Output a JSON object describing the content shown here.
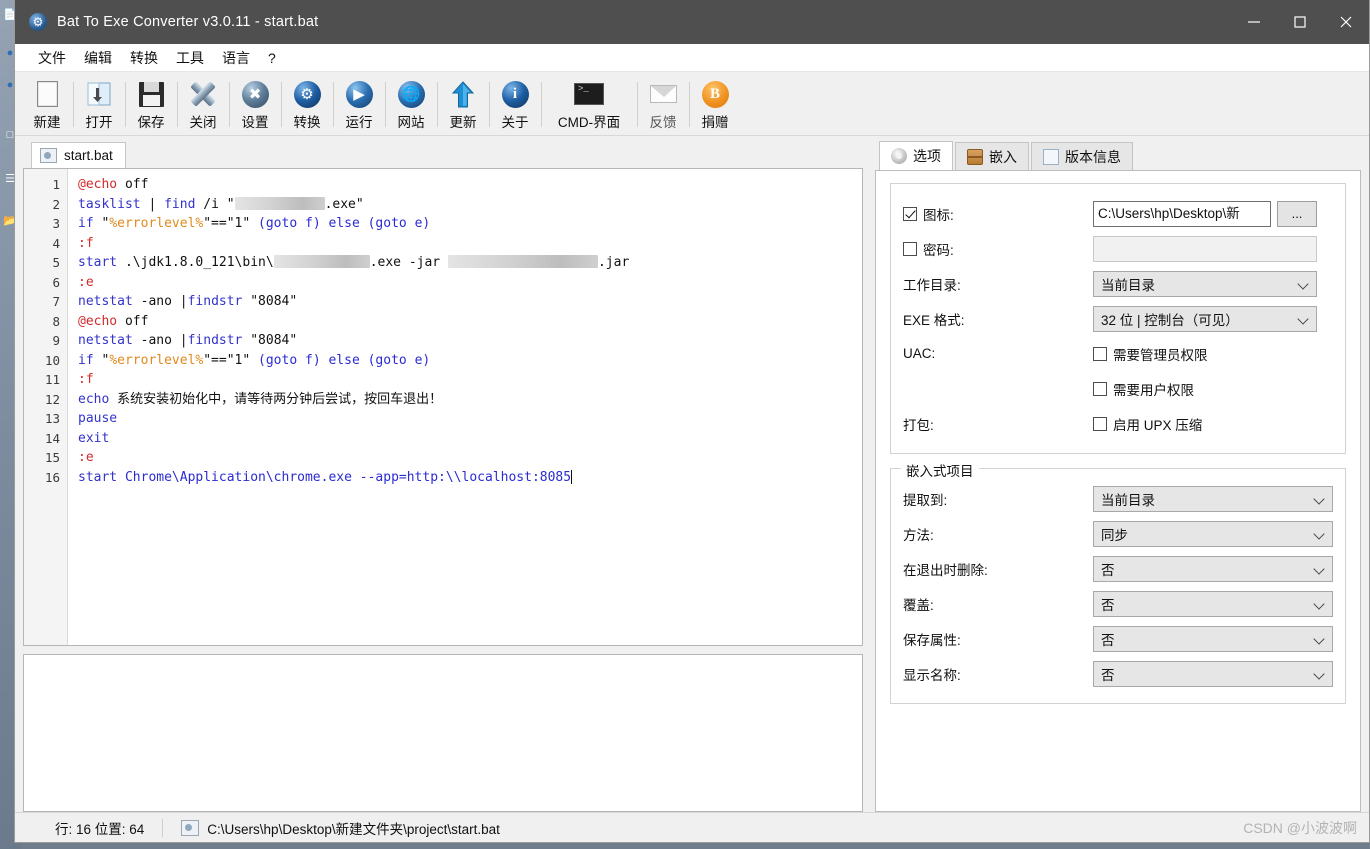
{
  "window": {
    "title": "Bat To Exe Converter v3.0.11 - start.bat",
    "app_icon": "gear-icon",
    "minimize": "minimize-icon",
    "maximize": "maximize-icon",
    "close": "close-icon"
  },
  "menu": {
    "items": [
      {
        "label": "文件"
      },
      {
        "label": "编辑"
      },
      {
        "label": "转换"
      },
      {
        "label": "工具"
      },
      {
        "label": "语言"
      },
      {
        "label": "?"
      }
    ]
  },
  "toolbar": {
    "items": [
      {
        "label": "新建",
        "icon": "new-file-icon"
      },
      {
        "label": "打开",
        "icon": "open-folder-icon"
      },
      {
        "label": "保存",
        "icon": "save-floppy-icon"
      },
      {
        "label": "关闭",
        "icon": "close-x-icon"
      },
      {
        "label": "设置",
        "icon": "settings-tools-icon"
      },
      {
        "label": "转换",
        "icon": "convert-gear-icon"
      },
      {
        "label": "运行",
        "icon": "run-play-icon"
      },
      {
        "label": "网站",
        "icon": "website-globe-icon"
      },
      {
        "label": "更新",
        "icon": "update-arrow-up-icon"
      },
      {
        "label": "关于",
        "icon": "about-info-icon"
      },
      {
        "label": "CMD-界面",
        "icon": "cmd-console-icon"
      },
      {
        "label": "反馈",
        "icon": "feedback-mail-icon"
      },
      {
        "label": "捐赠",
        "icon": "donate-bitcoin-icon"
      }
    ]
  },
  "editor": {
    "tab_label": "start.bat",
    "tab_icon": "bat-file-icon",
    "line_numbers": [
      1,
      2,
      3,
      4,
      5,
      6,
      7,
      8,
      9,
      10,
      11,
      12,
      13,
      14,
      15,
      16
    ],
    "lines": [
      {
        "n": 1,
        "tokens": [
          {
            "t": "@echo",
            "c": "at"
          },
          {
            "t": " off",
            "c": "plain"
          }
        ]
      },
      {
        "n": 2,
        "tokens": [
          {
            "t": "tasklist",
            "c": "kw"
          },
          {
            "t": " ",
            "c": "plain"
          },
          {
            "t": "|",
            "c": "pipe"
          },
          {
            "t": " ",
            "c": "plain"
          },
          {
            "t": "find",
            "c": "kw"
          },
          {
            "t": " /i \"",
            "c": "plain"
          },
          {
            "t": "REDACT:90",
            "c": "redact"
          },
          {
            "t": ".exe\"",
            "c": "plain"
          }
        ]
      },
      {
        "n": 3,
        "tokens": [
          {
            "t": "if",
            "c": "kw"
          },
          {
            "t": " \"",
            "c": "plain"
          },
          {
            "t": "%errorlevel%",
            "c": "var"
          },
          {
            "t": "\"==\"1\" ",
            "c": "plain"
          },
          {
            "t": "(goto f) else (goto e)",
            "c": "kw2"
          }
        ]
      },
      {
        "n": 4,
        "tokens": [
          {
            "t": ":f",
            "c": "label"
          }
        ]
      },
      {
        "n": 5,
        "tokens": [
          {
            "t": "start",
            "c": "kw"
          },
          {
            "t": " .\\jdk1.8.0_121\\bin\\",
            "c": "plain"
          },
          {
            "t": "REDACT:96",
            "c": "redact"
          },
          {
            "t": ".exe -jar ",
            "c": "plain"
          },
          {
            "t": "REDACT:150",
            "c": "redact"
          },
          {
            "t": ".jar",
            "c": "plain"
          }
        ]
      },
      {
        "n": 6,
        "tokens": [
          {
            "t": ":e",
            "c": "label"
          }
        ]
      },
      {
        "n": 7,
        "tokens": [
          {
            "t": "netstat",
            "c": "kw"
          },
          {
            "t": " -ano ",
            "c": "plain"
          },
          {
            "t": "|",
            "c": "pipe"
          },
          {
            "t": "findstr",
            "c": "kw"
          },
          {
            "t": " \"8084\"",
            "c": "plain"
          }
        ]
      },
      {
        "n": 8,
        "tokens": [
          {
            "t": "@echo",
            "c": "at"
          },
          {
            "t": " off",
            "c": "plain"
          }
        ]
      },
      {
        "n": 9,
        "tokens": [
          {
            "t": "netstat",
            "c": "kw"
          },
          {
            "t": " -ano ",
            "c": "plain"
          },
          {
            "t": "|",
            "c": "pipe"
          },
          {
            "t": "findstr",
            "c": "kw"
          },
          {
            "t": " \"8084\"",
            "c": "plain"
          }
        ]
      },
      {
        "n": 10,
        "tokens": [
          {
            "t": "if",
            "c": "kw"
          },
          {
            "t": " \"",
            "c": "plain"
          },
          {
            "t": "%errorlevel%",
            "c": "var"
          },
          {
            "t": "\"==\"1\" ",
            "c": "plain"
          },
          {
            "t": "(goto f) else (goto e)",
            "c": "kw2"
          }
        ]
      },
      {
        "n": 11,
        "tokens": [
          {
            "t": ":f",
            "c": "label"
          }
        ]
      },
      {
        "n": 12,
        "tokens": [
          {
            "t": "echo",
            "c": "kw"
          },
          {
            "t": " 系统安装初始化中，请等待两分钟后尝试，按回车退出！",
            "c": "plain"
          }
        ]
      },
      {
        "n": 13,
        "tokens": [
          {
            "t": "pause",
            "c": "kw"
          }
        ]
      },
      {
        "n": 14,
        "tokens": [
          {
            "t": "exit",
            "c": "kw"
          }
        ]
      },
      {
        "n": 15,
        "tokens": [
          {
            "t": ":e",
            "c": "label"
          }
        ]
      },
      {
        "n": 16,
        "tokens": [
          {
            "t": "start",
            "c": "kw"
          },
          {
            "t": " Chrome\\Application\\chrome.exe --app=http:\\\\localhost:8085",
            "c": "kw2"
          },
          {
            "t": "CARET",
            "c": "caret"
          }
        ]
      }
    ]
  },
  "options_panel": {
    "tabs": [
      {
        "label": "选项",
        "icon": "gear-icon",
        "active": true
      },
      {
        "label": "嵌入",
        "icon": "package-icon",
        "active": false
      },
      {
        "label": "版本信息",
        "icon": "document-icon",
        "active": false
      }
    ],
    "general_group": {
      "icon_row": {
        "label": "图标:",
        "checked": true,
        "value": "C:\\Users\\hp\\Desktop\\新",
        "browse_label": "..."
      },
      "password_row": {
        "label": "密码:",
        "checked": false,
        "value": ""
      },
      "workdir_row": {
        "label": "工作目录:",
        "value": "当前目录"
      },
      "exeformat_row": {
        "label": "EXE 格式:",
        "value": "32 位 | 控制台（可见）"
      },
      "uac_row": {
        "label": "UAC:",
        "options": [
          {
            "label": "需要管理员权限",
            "checked": false
          },
          {
            "label": "需要用户权限",
            "checked": false
          }
        ]
      },
      "pack_row": {
        "label": "打包:",
        "options": [
          {
            "label": "启用 UPX 压缩",
            "checked": false
          }
        ]
      }
    },
    "embedded_group": {
      "title": "嵌入式项目",
      "rows": [
        {
          "label": "提取到:",
          "value": "当前目录"
        },
        {
          "label": "方法:",
          "value": "同步"
        },
        {
          "label": "在退出时删除:",
          "value": "否"
        },
        {
          "label": "覆盖:",
          "value": "否"
        },
        {
          "label": "保存属性:",
          "value": "否"
        },
        {
          "label": "显示名称:",
          "value": "否"
        }
      ]
    }
  },
  "status_bar": {
    "position": "行: 16  位置: 64",
    "file_icon": "bat-file-icon",
    "file_path": "C:\\Users\\hp\\Desktop\\新建文件夹\\project\\start.bat",
    "watermark": "CSDN @小波波啊"
  },
  "colors": {
    "titlebar": "#4f4f4f",
    "window_bg": "#f0f0f0",
    "keyword": "#3333cc",
    "at_sign": "#d22b2b",
    "variable": "#e08a1e",
    "label": "#d22b2b"
  }
}
